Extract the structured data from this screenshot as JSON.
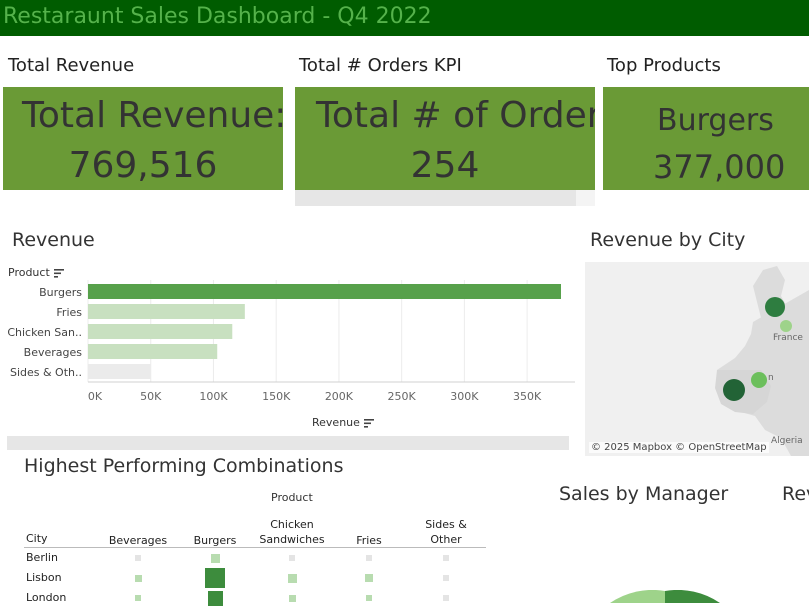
{
  "header": {
    "title": "Restaraunt Sales Dashboard - Q4 2022"
  },
  "kpis": [
    {
      "caption": "Total Revenue",
      "heading": "Total Revenue:",
      "value": "769,516"
    },
    {
      "caption": "Total # Orders KPI",
      "heading": "Total # of Orders",
      "value": "254"
    },
    {
      "caption": "Top Products",
      "heading": "Burgers",
      "value": "377,000"
    }
  ],
  "revenue_chart": {
    "title": "Revenue",
    "product_label": "Product",
    "axis_label": "Revenue"
  },
  "map": {
    "title": "Revenue by City",
    "labels": {
      "france": "France",
      "algeria": "Algeria",
      "partial_city": "n"
    },
    "attribution": "© 2025 Mapbox  © OpenStreetMap"
  },
  "combinations": {
    "title": "Highest Performing Combinations",
    "column_group": "Product",
    "row_header": "City",
    "columns": [
      "Beverages",
      "Burgers",
      "Chicken\nSandwiches",
      "Fries",
      "Sides &\nOther"
    ],
    "rows": [
      "Berlin",
      "Lisbon",
      "London"
    ],
    "cells": [
      [
        0.2,
        0.45,
        0.25,
        0.2,
        0.1
      ],
      [
        0.35,
        1.0,
        0.45,
        0.4,
        0.2
      ],
      [
        0.3,
        0.75,
        0.35,
        0.3,
        0.15
      ]
    ]
  },
  "manager": {
    "title": "Sales by Manager",
    "next_title": "Rev"
  },
  "colors": {
    "title_bg": "#005c00",
    "title_text": "#55b24b",
    "kpi_bg": "#6a9a36",
    "bar_top": "#57a14b",
    "bar_other": "#c8e0c0",
    "bar_last": "#ebebeb",
    "heat_dark": "#3d8c3d",
    "heat_light": "#b8dcb0",
    "map_dark": "#2e7d40",
    "map_light": "#9ed38a"
  },
  "chart_data": {
    "type": "bar",
    "orientation": "horizontal",
    "categories": [
      "Burgers",
      "Fries",
      "Chicken San..",
      "Beverages",
      "Sides & Oth.."
    ],
    "values": [
      377000,
      125000,
      115000,
      103000,
      50000
    ],
    "xlim": [
      0,
      380000
    ],
    "ticks": [
      "0K",
      "50K",
      "100K",
      "150K",
      "200K",
      "250K",
      "300K",
      "350K"
    ],
    "tick_values": [
      0,
      50000,
      100000,
      150000,
      200000,
      250000,
      300000,
      350000
    ],
    "xlabel": "Revenue",
    "ylabel": "Product"
  }
}
